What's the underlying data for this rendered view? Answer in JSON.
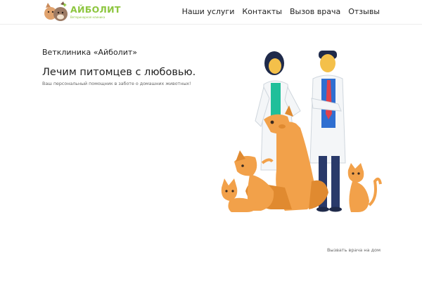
{
  "brand": {
    "name": "АЙБОЛИТ",
    "subtitle": "Ветеринарная клиника"
  },
  "nav": {
    "items": [
      {
        "label": "Наши услуги"
      },
      {
        "label": "Контакты"
      },
      {
        "label": "Вызов врача"
      },
      {
        "label": "Отзывы"
      }
    ]
  },
  "hero": {
    "clinic_name": "Ветклиника «Айболит»",
    "headline": "Лечим питомцев с любовью.",
    "tagline": "Ваш персональный помощник в заботе о домашних животных!"
  },
  "footer": {
    "call_link": "Вызвать врача на дом"
  },
  "colors": {
    "accent": "#8dc63f",
    "animal_orange": "#f2a14a",
    "coat_white": "#f4f6f8",
    "scrubs_teal": "#1fbf9a",
    "shirt_blue": "#2f6fd1",
    "trousers_navy": "#2a3a6a"
  }
}
